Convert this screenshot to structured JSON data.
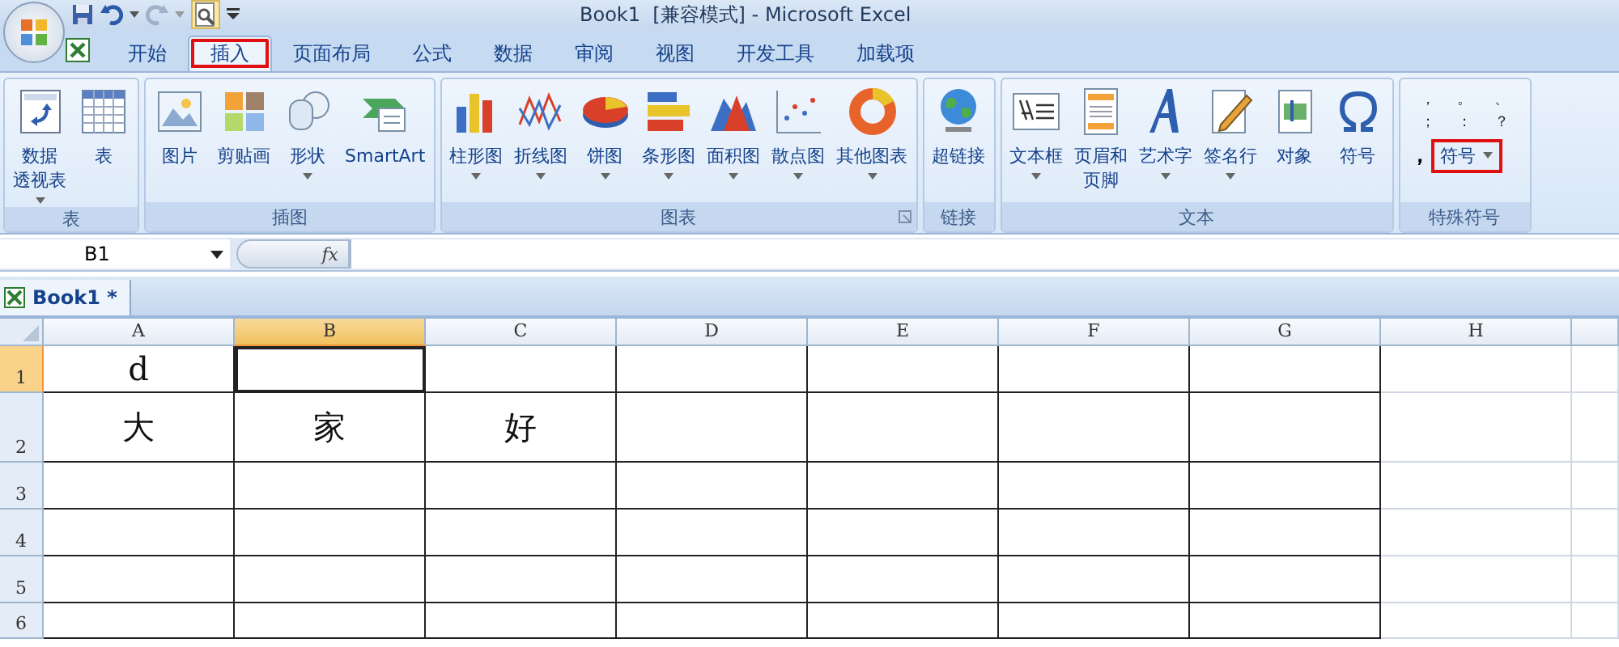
{
  "window": {
    "title": "Book1  [兼容模式] - Microsoft Excel"
  },
  "tabs": [
    {
      "label": "开始",
      "selected": false,
      "annotated": false
    },
    {
      "label": "插入",
      "selected": true,
      "annotated": true
    },
    {
      "label": "页面布局",
      "selected": false,
      "annotated": false
    },
    {
      "label": "公式",
      "selected": false,
      "annotated": false
    },
    {
      "label": "数据",
      "selected": false,
      "annotated": false
    },
    {
      "label": "审阅",
      "selected": false,
      "annotated": false
    },
    {
      "label": "视图",
      "selected": false,
      "annotated": false
    },
    {
      "label": "开发工具",
      "selected": false,
      "annotated": false
    },
    {
      "label": "加载项",
      "selected": false,
      "annotated": false
    }
  ],
  "ribbon_groups": [
    {
      "label": "表",
      "launcher": false,
      "buttons": [
        {
          "kind": "pivot",
          "label": [
            "数据",
            "透视表"
          ],
          "dropdown": true
        },
        {
          "kind": "table",
          "label": "表",
          "dropdown": false
        }
      ]
    },
    {
      "label": "插图",
      "launcher": false,
      "buttons": [
        {
          "kind": "picture",
          "label": "图片",
          "dropdown": false
        },
        {
          "kind": "clipart",
          "label": "剪贴画",
          "dropdown": false
        },
        {
          "kind": "shapes",
          "label": "形状",
          "dropdown": true
        },
        {
          "kind": "smartart",
          "label": "SmartArt",
          "dropdown": false
        }
      ]
    },
    {
      "label": "图表",
      "launcher": true,
      "buttons": [
        {
          "kind": "column",
          "label": "柱形图",
          "dropdown": true
        },
        {
          "kind": "line",
          "label": "折线图",
          "dropdown": true
        },
        {
          "kind": "pie",
          "label": "饼图",
          "dropdown": true
        },
        {
          "kind": "bar",
          "label": "条形图",
          "dropdown": true
        },
        {
          "kind": "area",
          "label": "面积图",
          "dropdown": true
        },
        {
          "kind": "scatter",
          "label": "散点图",
          "dropdown": true
        },
        {
          "kind": "donut",
          "label": "其他图表",
          "dropdown": true
        }
      ]
    },
    {
      "label": "链接",
      "launcher": false,
      "buttons": [
        {
          "kind": "globe",
          "label": "超链接",
          "dropdown": false
        }
      ]
    },
    {
      "label": "文本",
      "launcher": false,
      "buttons": [
        {
          "kind": "textbox",
          "label": "文本框",
          "dropdown": true
        },
        {
          "kind": "header",
          "label": [
            "页眉和",
            "页脚"
          ],
          "dropdown": false
        },
        {
          "kind": "wordart",
          "label": "艺术字",
          "dropdown": true
        },
        {
          "kind": "signature",
          "label": "签名行",
          "dropdown": true
        },
        {
          "kind": "object",
          "label": "对象",
          "dropdown": false
        },
        {
          "kind": "omega",
          "label": "符号",
          "dropdown": false
        }
      ]
    }
  ],
  "special_symbols": {
    "label": "特殊符号",
    "symbols": [
      "，",
      "。",
      "、",
      "；",
      "：",
      "？"
    ],
    "big_symbol": "，",
    "button": {
      "label": "符号",
      "annotated": true
    }
  },
  "formula_bar": {
    "name_box": "B1",
    "fx": "fx"
  },
  "workbook_tab": {
    "label": "Book1 *"
  },
  "sheet": {
    "columns": [
      {
        "label": "A",
        "selected": false,
        "bordered": true
      },
      {
        "label": "B",
        "selected": true,
        "bordered": true
      },
      {
        "label": "C",
        "selected": false,
        "bordered": true
      },
      {
        "label": "D",
        "selected": false,
        "bordered": true
      },
      {
        "label": "E",
        "selected": false,
        "bordered": true
      },
      {
        "label": "F",
        "selected": false,
        "bordered": true
      },
      {
        "label": "G",
        "selected": false,
        "bordered": true
      },
      {
        "label": "H",
        "selected": false,
        "bordered": false
      }
    ],
    "rows": [
      {
        "label": "1",
        "selected": true,
        "cells": [
          "d"
        ]
      },
      {
        "label": "2",
        "selected": false,
        "cells": [
          "大",
          "家",
          "好"
        ]
      },
      {
        "label": "3",
        "selected": false
      },
      {
        "label": "4",
        "selected": false
      },
      {
        "label": "5",
        "selected": false
      },
      {
        "label": "6",
        "selected": false
      }
    ]
  }
}
